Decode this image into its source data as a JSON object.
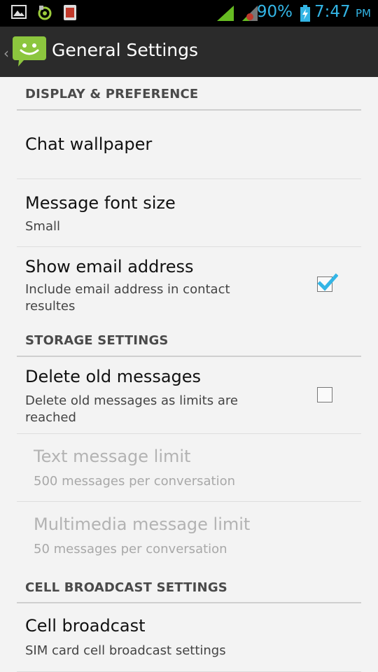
{
  "status_bar": {
    "battery_percent_text": "90%",
    "time": "7:47",
    "ampm": "PM",
    "icons": [
      "picture-notification-icon",
      "recycle-notification-icon",
      "hand-notification-icon",
      "signal-icon",
      "signal-icon-2",
      "battery-charging-icon"
    ]
  },
  "action_bar": {
    "title": "General Settings",
    "icon": "messaging-app-icon"
  },
  "sections": {
    "display": {
      "title": "DISPLAY & PREFERENCE"
    },
    "storage": {
      "title": "STORAGE SETTINGS"
    },
    "cell": {
      "title": "CELL BROADCAST SETTINGS"
    }
  },
  "prefs": {
    "chat_wallpaper": {
      "title": "Chat wallpaper"
    },
    "font_size": {
      "title": "Message font size",
      "summary": "Small"
    },
    "show_email": {
      "title": "Show email address",
      "summary": "Include email address in contact resultes",
      "checked": true
    },
    "delete_old": {
      "title": "Delete old messages",
      "summary": "Delete old messages as limits are reached",
      "checked": false
    },
    "text_limit": {
      "title": "Text message limit",
      "summary": "500 messages per conversation",
      "enabled": false
    },
    "mms_limit": {
      "title": "Multimedia message limit",
      "summary": "50 messages per conversation",
      "enabled": false
    },
    "cell_broadcast": {
      "title": "Cell broadcast",
      "summary": "SIM card cell broadcast settings"
    }
  },
  "colors": {
    "accent": "#33b5e5",
    "action_bar": "#2b2b2b",
    "background": "#f3f3f3",
    "app_icon_green": "#8cc63e"
  }
}
